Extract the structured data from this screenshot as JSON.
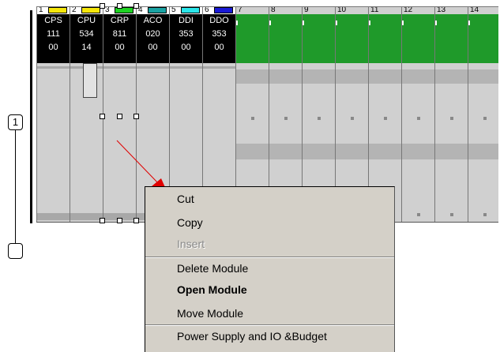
{
  "callouts": {
    "one": "1"
  },
  "slots": [
    {
      "num": "1",
      "bar": "#f5e60a",
      "l1": "CPS",
      "l2": "111",
      "l3": "00"
    },
    {
      "num": "2",
      "bar": "#f5e60a",
      "l1": "CPU",
      "l2": "534",
      "l3": "14"
    },
    {
      "num": "3",
      "bar": "#1fd323",
      "l1": "CRP",
      "l2": "811",
      "l3": "00"
    },
    {
      "num": "4",
      "bar": "#1aa3a3",
      "l1": "ACO",
      "l2": "020",
      "l3": "00"
    },
    {
      "num": "5",
      "bar": "#2ae6ea",
      "l1": "DDI",
      "l2": "353",
      "l3": "00"
    },
    {
      "num": "6",
      "bar": "#1a1ad6",
      "l1": "DDO",
      "l2": "353",
      "l3": "00"
    }
  ],
  "empty_slots": [
    "7",
    "8",
    "9",
    "10",
    "11",
    "12",
    "13",
    "14"
  ],
  "context_menu": {
    "items": [
      {
        "label": "Cut",
        "state": "normal"
      },
      {
        "label": "Copy",
        "state": "normal"
      },
      {
        "label": "Insert",
        "state": "disabled"
      },
      {
        "label": "Delete Module",
        "state": "normal"
      },
      {
        "label": "Open Module",
        "state": "bold"
      },
      {
        "label": "Move Module",
        "state": "normal"
      },
      {
        "label": "Power Supply and IO &Budget",
        "state": "normal"
      }
    ]
  },
  "colors": {
    "rack_green": "#1f9a2a",
    "menu_bg": "#d4d0c8",
    "arrow": "#e00000"
  }
}
